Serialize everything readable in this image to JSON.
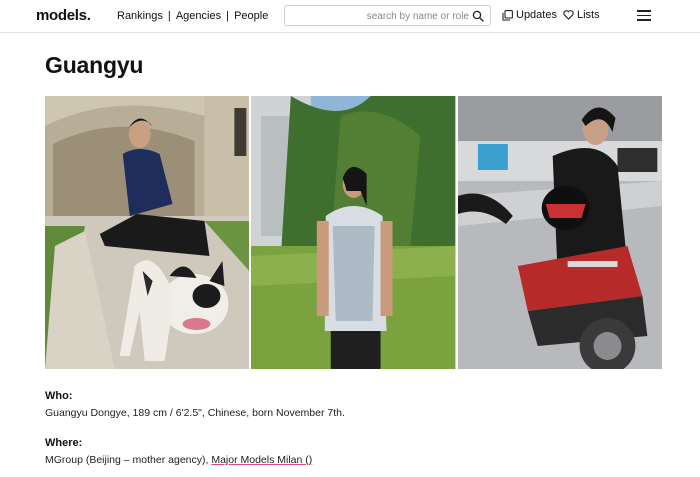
{
  "header": {
    "logo": "models.",
    "nav": [
      "Rankings",
      "Agencies",
      "People"
    ],
    "search_placeholder": "search by name or role",
    "updates_label": "Updates",
    "lists_label": "Lists"
  },
  "profile": {
    "name": "Guangyu",
    "who_label": "Who:",
    "who_text": "Guangyu Dongye, 189 cm / 6'2.5\", Chinese, born November 7th.",
    "where_label": "Where:",
    "where_text_prefix": "MGroup (Beijing – mother agency), ",
    "where_link": "Major Models Milan ()"
  },
  "colors": {
    "accent_underline": "#e0457b",
    "border": "#e2e2e2"
  },
  "icons": [
    "search-icon",
    "updates-icon",
    "heart-icon",
    "hamburger-menu-icon"
  ]
}
